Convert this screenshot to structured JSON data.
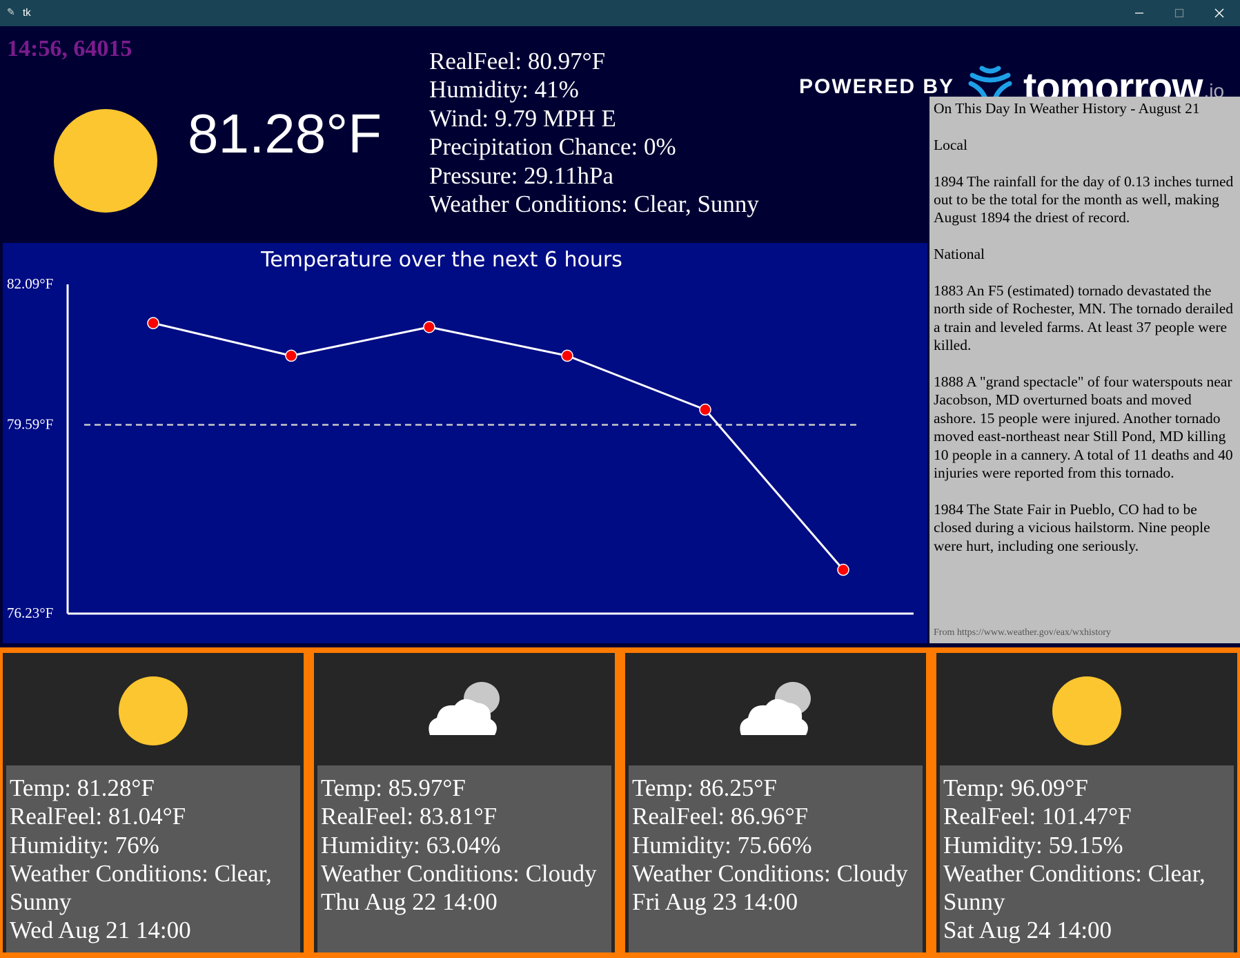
{
  "window": {
    "title": "tk"
  },
  "header": {
    "clock": "14:56, 64015",
    "current_temp": "81.28°F",
    "details": [
      "RealFeel: 80.97°F",
      "Humidity: 41%",
      "Wind: 9.79 MPH E",
      "Precipitation Chance: 0%",
      "Pressure: 29.11hPa",
      "Weather Conditions: Clear, Sunny"
    ],
    "current_icon": "sun-icon"
  },
  "branding": {
    "powered_by": "POWERED BY",
    "brand": "tomorrow",
    "suffix": ".io",
    "logo_icon": "tomorrow-io-logo-icon"
  },
  "history": {
    "paragraphs": [
      "On This Day In Weather History - August 21",
      "Local",
      "1894 The rainfall for the day of 0.13 inches turned out to be the total for the month as well, making August 1894 the driest of record.",
      "National",
      "1883 An F5 (estimated) tornado devastated the north side of Rochester, MN.  The tornado derailed a train and leveled farms.  At least 37 people were killed.",
      "1888 A \"grand spectacle\" of four waterspouts near Jacobson, MD overturned boats and moved ashore.  15 people were injured. Another tornado moved east-northeast near Still Pond, MD killing 10 people in a cannery. A total of 11 deaths and 40 injuries were reported from this tornado.",
      "1984 The State Fair in Pueblo, CO had to be closed during a vicious hailstorm. Nine people were hurt, including one seriously."
    ],
    "source": "From https://www.weather.gov/eax/wxhistory"
  },
  "chart_data": {
    "type": "line",
    "title": "Temperature over the next 6 hours",
    "x": [
      1,
      2,
      3,
      4,
      5,
      6
    ],
    "values": [
      81.4,
      80.82,
      81.33,
      80.82,
      79.86,
      77.01
    ],
    "y_tick_labels": [
      "82.09°F",
      "79.59°F",
      "76.23°F"
    ],
    "y_ticks": [
      82.09,
      79.59,
      76.23
    ],
    "ylim": [
      76.23,
      82.09
    ],
    "reference_line": 79.59,
    "colors": {
      "background": "#000c84",
      "line": "#ffffff",
      "point": "#ff0000",
      "reference": "#c8c8c8"
    }
  },
  "forecast": [
    {
      "icon": "sun-icon",
      "lines": [
        "Temp: 81.28°F",
        "RealFeel: 81.04°F",
        "Humidity: 76%",
        "Weather Conditions: Clear, Sunny",
        "Wed Aug 21 14:00"
      ]
    },
    {
      "icon": "cloud-icon",
      "lines": [
        "Temp: 85.97°F",
        "RealFeel: 83.81°F",
        "Humidity: 63.04%",
        "Weather Conditions: Cloudy",
        "Thu Aug 22 14:00"
      ]
    },
    {
      "icon": "cloud-icon",
      "lines": [
        "Temp: 86.25°F",
        "RealFeel: 86.96°F",
        "Humidity: 75.66%",
        "Weather Conditions: Cloudy",
        "Fri Aug 23 14:00"
      ]
    },
    {
      "icon": "sun-icon",
      "lines": [
        "Temp: 96.09°F",
        "RealFeel: 101.47°F",
        "Humidity: 59.15%",
        "Weather Conditions: Clear, Sunny",
        "Sat Aug 24 14:00"
      ]
    }
  ],
  "colors": {
    "sun": "#fbc62f",
    "clock": "#7b1c8c",
    "card_border": "#ff7a00",
    "history_bg": "#bfbfbf",
    "card_bg": "#262626",
    "card_info_bg": "#595959"
  }
}
